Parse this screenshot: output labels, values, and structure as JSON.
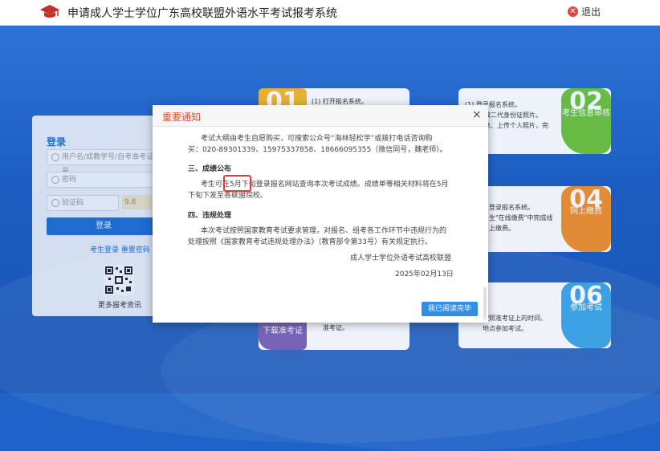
{
  "header": {
    "title": "申请成人学士学位广东高校联盟外语水平考试报考系统",
    "logout_label": "退出"
  },
  "login": {
    "title": "登录",
    "username_placeholder": "用户名/成教学号/自考准考证号",
    "password_placeholder": "密码",
    "captcha_placeholder": "验证码",
    "captcha_text": "9.8",
    "login_button": "登录",
    "links": "考生登录 重置密码",
    "qr_caption": "更多报考资讯"
  },
  "steps": [
    {
      "text": "(1) 打开报名系统。",
      "num": "01",
      "label": ""
    },
    {
      "text_lines": [
        "(1) 登录报名系统。",
        "个人有效二代身份证照片。",
        "报名信息、上传个人照片，完",
        "证核验。"
      ],
      "num": "02",
      "label": "考生信息审核"
    },
    {
      "text_lines": [
        "登录报名系统。",
        "生\"在线缴费\"中完成线",
        "上缴费。"
      ],
      "num": "04",
      "label": "网上缴费"
    },
    {
      "text_lines": [
        "下载准考证"
      ],
      "num": "",
      "label": "准考证。"
    },
    {
      "text_lines": [
        "按照准考证上的时间、",
        "地点参加考试。"
      ],
      "num": "06",
      "label": "参加考试"
    }
  ],
  "modal": {
    "title": "重要通知",
    "close": "×",
    "lines": [
      "考试大纲由考生自愿购买，可搜索公众号“海林轻松学”或拨打电话咨询购",
      "买：020-89301339、15975337858、18666095355（微信同号，魏老师）。",
      "三、成绩公布",
      "考生可在5月下旬登录报名网站查询本次考试成绩。成绩单等相关材料将在5月",
      "下旬下发至各联盟院校。",
      "四、违规处理",
      "本次考试按照国家教育考试要求管理，对报名、组考各工作环节中违规行为的",
      "处理按照《国家教育考试违规处理办法》（教育部令第33号）有关规定执行。",
      "成人学士学位外语考试高校联盟",
      "2025年02月13日"
    ],
    "read_button": "我已阅读完毕"
  },
  "colors": {
    "background": "#1e63c8",
    "accent": "#1f6fd3",
    "badge_green": "#6cc33a",
    "badge_orange": "#f2902a",
    "badge_blue": "#3fa6e8",
    "badge_purple": "#7d63b5",
    "badge_yellow": "#f5b82a",
    "notice_title": "#e34b2c",
    "highlight": "#e23a3a"
  },
  "icons": {
    "logo": "graduation-cap-icon",
    "logout": "close-circle-icon",
    "close": "close-icon"
  }
}
